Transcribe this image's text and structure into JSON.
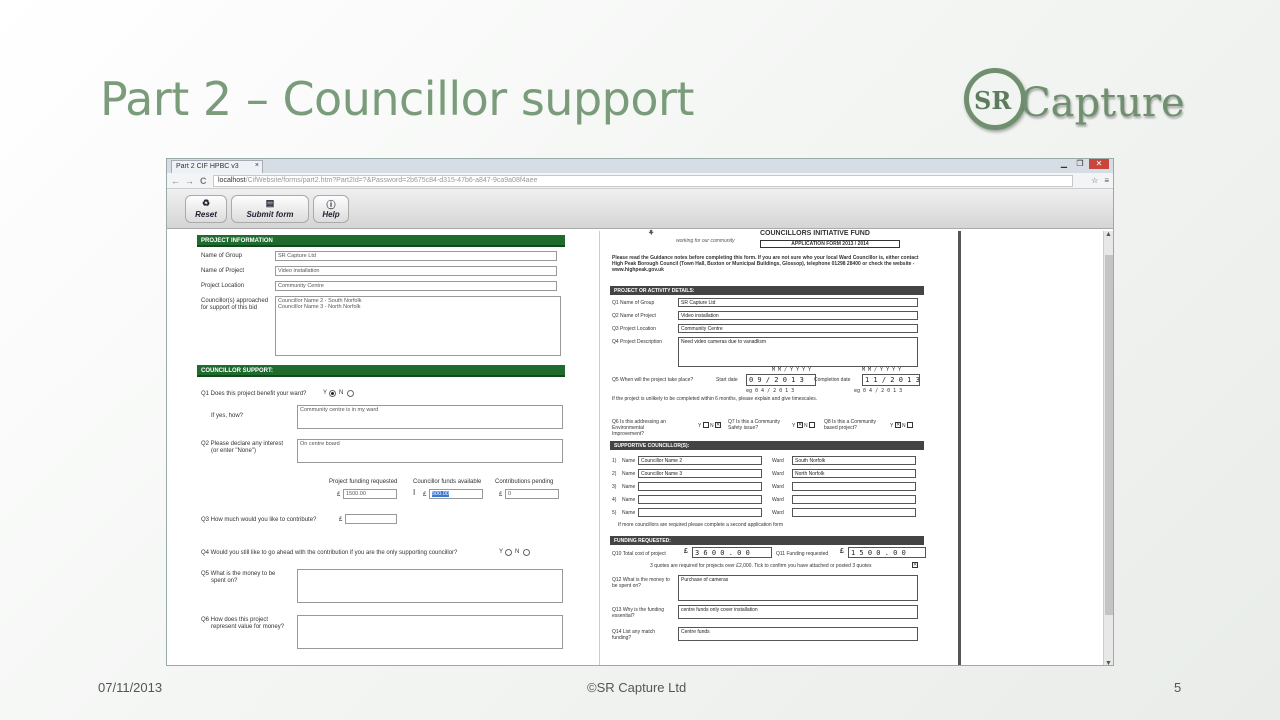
{
  "slide": {
    "title": "Part 2 – Councillor support",
    "logo_sr": "SR",
    "logo_word": "Capture",
    "footer_date": "07/11/2013",
    "footer_center": "©SR Capture Ltd",
    "footer_page": "5"
  },
  "browser": {
    "tab_title": "Part 2 CIF HPBC v3",
    "tab_close": "×",
    "url_host": "localhost",
    "url_path": "/CifWebsite/forms/part2.htm?Part2Id=?&Password=2b675c84-d315-47b6-a847-9ca9a08f4aee",
    "win_min": "▁",
    "win_max": "❐",
    "win_close": "✕",
    "back": "←",
    "forward": "→",
    "reload": "C",
    "star": "☆",
    "menu": "≡"
  },
  "toolbar": {
    "reset": "Reset",
    "submit": "Submit form",
    "help": "Help"
  },
  "left_form": {
    "project_info_header": "PROJECT INFORMATION",
    "name_of_group_label": "Name of Group",
    "name_of_group_value": "SR Capture Ltd",
    "name_of_project_label": "Name of Project",
    "name_of_project_value": "Video installation",
    "project_location_label": "Project Location",
    "project_location_value": "Community Centre",
    "councillors_label_1": "Councillor(s) approached",
    "councillors_label_2": "for support of this bid",
    "councillor_1": "Councillor Name 2 - South Norfolk",
    "councillor_2": "Councillor Name 3 - North Norfolk",
    "support_header": "COUNCILLOR SUPPORT:",
    "q1_label": "Q1 Does this project benefit your ward?",
    "q1_y": "Y",
    "q1_n": "N",
    "q1_how_label": "If yes, how?",
    "q1_how_value": "Community centre is in my ward",
    "q2_label_1": "Q2  Please declare any interest",
    "q2_label_2": "(or enter \"None\")",
    "q2_value": "On centre board",
    "funding_requested_label": "Project funding requested",
    "funds_available_label": "Councillor funds available",
    "contributions_label": "Contributions pending",
    "pound": "£",
    "funding_requested_value": "1500.00",
    "funds_available_value": "500.00",
    "contributions_value": "0",
    "q3_label": "Q3  How much would you like to contribute?",
    "q4_label": "Q4  Would you still like to go ahead with the contribution if you are the only supporting councillor?",
    "q4_y": "Y",
    "q4_n": "N",
    "q5_label_1": "Q5  What is the money to be",
    "q5_label_2": "spent on?",
    "q6_label_1": "Q6  How does this project",
    "q6_label_2": "represent value for money?"
  },
  "right_doc": {
    "title": "COUNCILLORS INITIATIVE FUND",
    "subtitle": "APPLICATION FORM 2013 / 2014",
    "tagline": "working for our community",
    "intro": "Please read the Guidance notes before completing this form. If you are not sure who your local Ward Councillor is, either contact High Peak Borough Council (Town Hall, Buxton or Municipal Buildings, Glossop), telephone 01298 28400 or check the website - www.highpeak.gov.uk",
    "project_details_header": "PROJECT OR ACTIVITY DETAILS:",
    "q1_label": "Q1 Name of Group",
    "q1_value": "SR Capture Ltd",
    "q2_label": "Q2 Name of Project",
    "q2_value": "Video installation",
    "q3_label": "Q3 Project Location",
    "q3_value": "Community Centre",
    "q4_label": "Q4 Project Description",
    "q4_value": "Need video cameras due to vanadlism",
    "q5_label": "Q5 When will the project take place?",
    "start_label": "Start date",
    "start_value": "0 9 / 2 0 1 3",
    "completion_label": "Completion date",
    "completion_value": "1 1 / 2 0 1 3",
    "date_hint": "M M  /  Y Y Y Y",
    "date_eg": "eg  0 4 / 2 0 1 3",
    "q5_note": "If the project is unlikely to be completed within 6 months, please explain and give timescales.",
    "q6_label": "Q6 Is this addressing an Environmental Improvement?",
    "q7_label": "Q7 Is this a Community Safety issue?",
    "q8_label": "Q8 Is this a Community based project?",
    "yn_y": "Y",
    "yn_n": "N",
    "supporting_header": "SUPPORTIVE COUNCILLOR(S):",
    "name_label": "Name",
    "ward_label": "Ward",
    "councillors": [
      {
        "num": "1)",
        "name": "Councillor Name 2",
        "ward": "South Norfolk"
      },
      {
        "num": "2)",
        "name": "Councillor Name 3",
        "ward": "North Norfolk"
      },
      {
        "num": "3)",
        "name": "",
        "ward": ""
      },
      {
        "num": "4)",
        "name": "",
        "ward": ""
      },
      {
        "num": "5)",
        "name": "",
        "ward": ""
      }
    ],
    "more_councillors_note": "If more councillors are required please complete a second application form",
    "funding_header": "FUNDING REQUESTED:",
    "q10_label": "Q10 Total cost of project",
    "q10_value": "3 6 0 0 . 0 0",
    "q11_label": "Q11 Funding requested",
    "q11_value": "1 5 0 0 . 0 0",
    "quotes_note": "3 quotes are required for projects over £2,000. Tick to confirm you have attached or posted 3 quotes",
    "q12_label": "Q12 What is the money to be spent on?",
    "q12_value": "Purchase of cameras",
    "q13_label": "Q13 Why is the funding essential?",
    "q13_value": "centre funds only cover installation",
    "q14_label": "Q14 List any match funding?",
    "q14_value": "Centre funds"
  }
}
